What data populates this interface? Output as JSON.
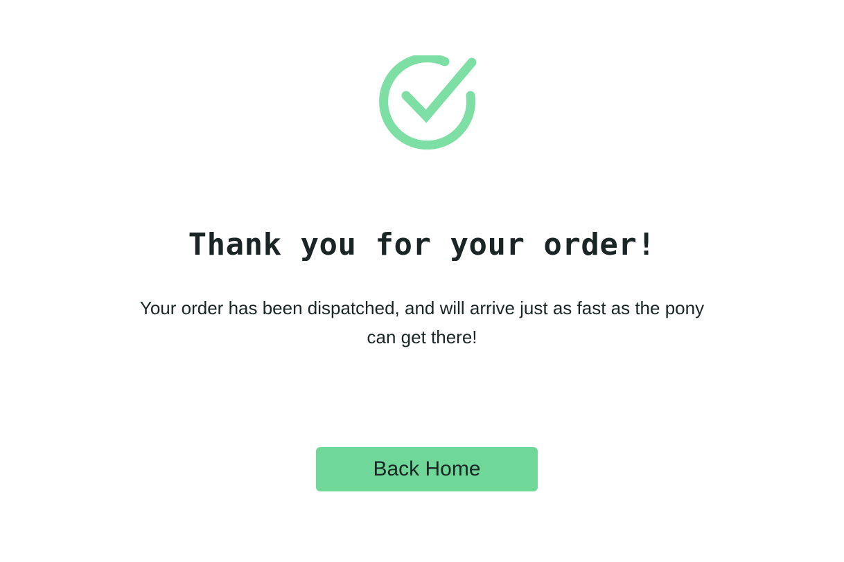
{
  "confirmation": {
    "icon": "check-circle-icon",
    "icon_color": "#7ddfa3",
    "title": "Thank you for your order!",
    "message": "Your order has been dispatched, and will arrive just as fast as the pony can get there!"
  },
  "actions": {
    "back_home_label": "Back Home",
    "button_color": "#6fd898"
  }
}
